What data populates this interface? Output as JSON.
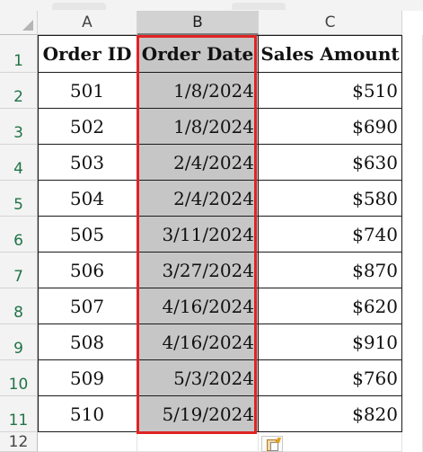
{
  "columns": [
    "A",
    "B",
    "C"
  ],
  "rows": [
    "1",
    "2",
    "3",
    "4",
    "5",
    "6",
    "7",
    "8",
    "9",
    "10",
    "11",
    "12"
  ],
  "headers": [
    "Order ID",
    "Order Date",
    "Sales Amount"
  ],
  "data": [
    [
      "501",
      "1/8/2024",
      "$510"
    ],
    [
      "502",
      "1/8/2024",
      "$690"
    ],
    [
      "503",
      "2/4/2024",
      "$630"
    ],
    [
      "504",
      "2/4/2024",
      "$580"
    ],
    [
      "505",
      "3/11/2024",
      "$740"
    ],
    [
      "506",
      "3/27/2024",
      "$870"
    ],
    [
      "507",
      "4/16/2024",
      "$620"
    ],
    [
      "508",
      "4/16/2024",
      "$910"
    ],
    [
      "509",
      "5/3/2024",
      "$760"
    ],
    [
      "510",
      "5/19/2024",
      "$820"
    ]
  ],
  "selected_column": "B",
  "highlight_color": "#e02323",
  "quick_analysis_icon": "quick-analysis-icon"
}
